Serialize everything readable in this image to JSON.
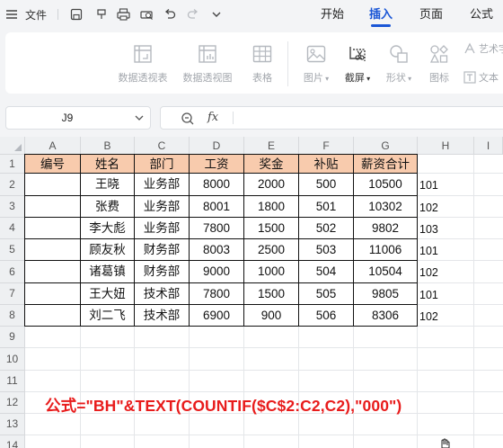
{
  "titlebar": {
    "menu_label": "文件",
    "icons": [
      "menu-icon",
      "save-icon",
      "format-painter-icon",
      "print-icon",
      "print-preview-icon",
      "undo-icon",
      "redo-icon",
      "more-dropdown-icon"
    ],
    "tabs": [
      {
        "label": "开始",
        "active": false
      },
      {
        "label": "插入",
        "active": true
      },
      {
        "label": "页面",
        "active": false
      },
      {
        "label": "公式",
        "active": false
      }
    ]
  },
  "ribbon": {
    "pivot_table": "数据透视表",
    "pivot_chart": "数据透视图",
    "table": "表格",
    "picture": "图片",
    "screenshot": "截屏",
    "shape": "形状",
    "icon": "图标",
    "art_text": "艺术字",
    "textbox": "文本"
  },
  "namebox": {
    "value": "J9"
  },
  "formula_bar": {
    "fx": "fx",
    "value": ""
  },
  "grid": {
    "columns": [
      "A",
      "B",
      "C",
      "D",
      "E",
      "F",
      "G",
      "H",
      "I"
    ],
    "rows": [
      "1",
      "2",
      "3",
      "4",
      "5",
      "6",
      "7",
      "8",
      "9",
      "10",
      "11",
      "12",
      "13",
      "14"
    ],
    "table_headers": [
      "编号",
      "姓名",
      "部门",
      "工资",
      "奖金",
      "补贴",
      "薪资合计"
    ],
    "table_rows": [
      {
        "id": "",
        "name": "王晓",
        "dept": "业务部",
        "salary": "8000",
        "bonus": "2000",
        "allowance": "500",
        "total": "10500",
        "h": "101"
      },
      {
        "id": "",
        "name": "张费",
        "dept": "业务部",
        "salary": "8001",
        "bonus": "1800",
        "allowance": "501",
        "total": "10302",
        "h": "102"
      },
      {
        "id": "",
        "name": "李大彪",
        "dept": "业务部",
        "salary": "7800",
        "bonus": "1500",
        "allowance": "502",
        "total": "9802",
        "h": "103"
      },
      {
        "id": "",
        "name": "顾友秋",
        "dept": "财务部",
        "salary": "8003",
        "bonus": "2500",
        "allowance": "503",
        "total": "11006",
        "h": "101"
      },
      {
        "id": "",
        "name": "诸葛镇",
        "dept": "财务部",
        "salary": "9000",
        "bonus": "1000",
        "allowance": "504",
        "total": "10504",
        "h": "102"
      },
      {
        "id": "",
        "name": "王大妞",
        "dept": "技术部",
        "salary": "7800",
        "bonus": "1500",
        "allowance": "505",
        "total": "9805",
        "h": "101"
      },
      {
        "id": "",
        "name": "刘二飞",
        "dept": "技术部",
        "salary": "6900",
        "bonus": "900",
        "allowance": "506",
        "total": "8306",
        "h": "102"
      }
    ],
    "formula_note": "公式=\"BH\"&TEXT(COUNTIF($C$2:C2,C2),\"000\")"
  },
  "colors": {
    "accent": "#1a56d6",
    "header_fill": "#f8cbad",
    "note_red": "#e81c1c"
  }
}
